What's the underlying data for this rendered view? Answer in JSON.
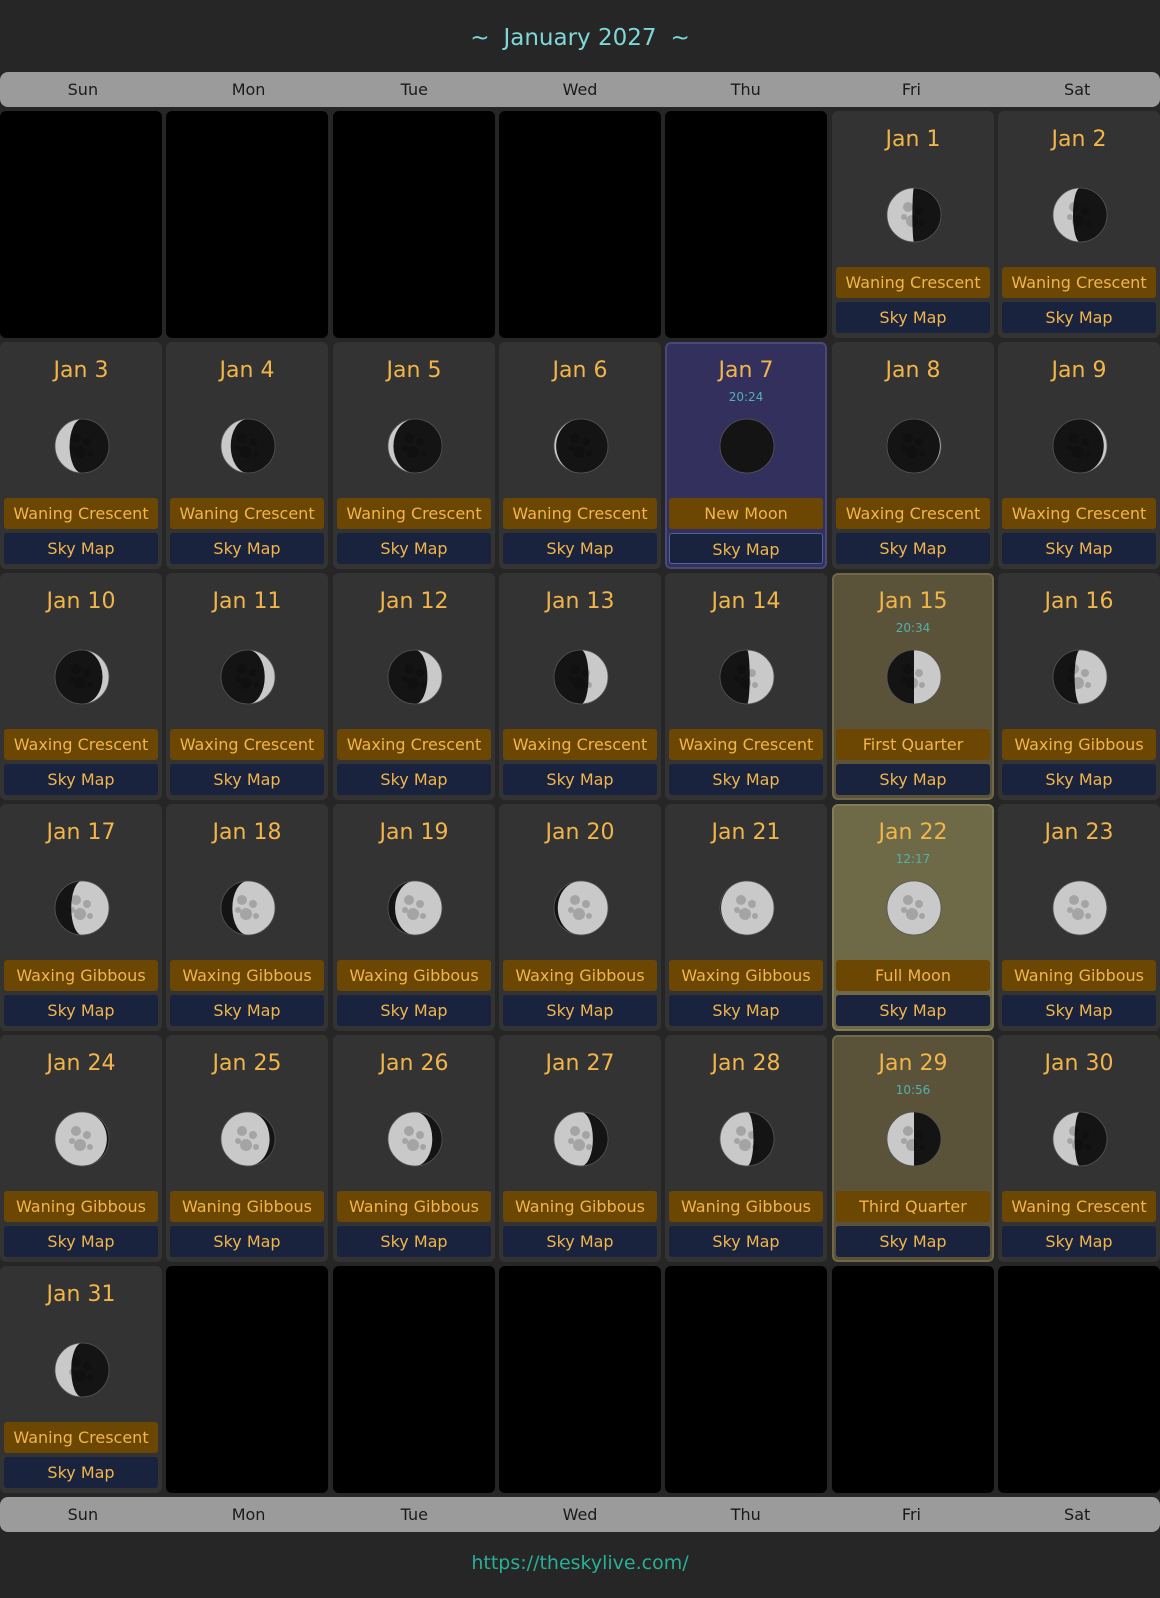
{
  "header": {
    "title": "January 2027",
    "tilde_left": "~",
    "tilde_right": "~"
  },
  "weekdays": [
    "Sun",
    "Mon",
    "Tue",
    "Wed",
    "Thu",
    "Fri",
    "Sat"
  ],
  "sky_map_label": "Sky Map",
  "leading_blanks": 5,
  "days": [
    {
      "label": "Jan 1",
      "phase": "Waning Crescent",
      "illum": 0.47,
      "waxing": false
    },
    {
      "label": "Jan 2",
      "phase": "Waning Crescent",
      "illum": 0.37,
      "waxing": false
    },
    {
      "label": "Jan 3",
      "phase": "Waning Crescent",
      "illum": 0.27,
      "waxing": false
    },
    {
      "label": "Jan 4",
      "phase": "Waning Crescent",
      "illum": 0.18,
      "waxing": false
    },
    {
      "label": "Jan 5",
      "phase": "Waning Crescent",
      "illum": 0.1,
      "waxing": false
    },
    {
      "label": "Jan 6",
      "phase": "Waning Crescent",
      "illum": 0.04,
      "waxing": false
    },
    {
      "label": "Jan 7",
      "time": "20:24",
      "phase": "New Moon",
      "illum": 0.0,
      "waxing": true,
      "highlight": "new"
    },
    {
      "label": "Jan 8",
      "phase": "Waxing Crescent",
      "illum": 0.02,
      "waxing": true
    },
    {
      "label": "Jan 9",
      "phase": "Waxing Crescent",
      "illum": 0.06,
      "waxing": true
    },
    {
      "label": "Jan 10",
      "phase": "Waxing Crescent",
      "illum": 0.12,
      "waxing": true
    },
    {
      "label": "Jan 11",
      "phase": "Waxing Crescent",
      "illum": 0.19,
      "waxing": true
    },
    {
      "label": "Jan 12",
      "phase": "Waxing Crescent",
      "illum": 0.27,
      "waxing": true
    },
    {
      "label": "Jan 13",
      "phase": "Waxing Crescent",
      "illum": 0.36,
      "waxing": true
    },
    {
      "label": "Jan 14",
      "phase": "Waxing Crescent",
      "illum": 0.45,
      "waxing": true
    },
    {
      "label": "Jan 15",
      "time": "20:34",
      "phase": "First Quarter",
      "illum": 0.5,
      "waxing": true,
      "highlight": "fq"
    },
    {
      "label": "Jan 16",
      "phase": "Waxing Gibbous",
      "illum": 0.6,
      "waxing": true
    },
    {
      "label": "Jan 17",
      "phase": "Waxing Gibbous",
      "illum": 0.7,
      "waxing": true
    },
    {
      "label": "Jan 18",
      "phase": "Waxing Gibbous",
      "illum": 0.79,
      "waxing": true
    },
    {
      "label": "Jan 19",
      "phase": "Waxing Gibbous",
      "illum": 0.87,
      "waxing": true
    },
    {
      "label": "Jan 20",
      "phase": "Waxing Gibbous",
      "illum": 0.93,
      "waxing": true
    },
    {
      "label": "Jan 21",
      "phase": "Waxing Gibbous",
      "illum": 0.98,
      "waxing": true
    },
    {
      "label": "Jan 22",
      "time": "12:17",
      "phase": "Full Moon",
      "illum": 1.0,
      "waxing": true,
      "highlight": "full"
    },
    {
      "label": "Jan 23",
      "phase": "Waning Gibbous",
      "illum": 0.99,
      "waxing": false
    },
    {
      "label": "Jan 24",
      "phase": "Waning Gibbous",
      "illum": 0.96,
      "waxing": false
    },
    {
      "label": "Jan 25",
      "phase": "Waning Gibbous",
      "illum": 0.9,
      "waxing": false
    },
    {
      "label": "Jan 26",
      "phase": "Waning Gibbous",
      "illum": 0.82,
      "waxing": false
    },
    {
      "label": "Jan 27",
      "phase": "Waning Gibbous",
      "illum": 0.72,
      "waxing": false
    },
    {
      "label": "Jan 28",
      "phase": "Waning Gibbous",
      "illum": 0.62,
      "waxing": false
    },
    {
      "label": "Jan 29",
      "time": "10:56",
      "phase": "Third Quarter",
      "illum": 0.5,
      "waxing": false,
      "highlight": "tq"
    },
    {
      "label": "Jan 30",
      "phase": "Waning Crescent",
      "illum": 0.4,
      "waxing": false
    },
    {
      "label": "Jan 31",
      "phase": "Waning Crescent",
      "illum": 0.3,
      "waxing": false
    }
  ],
  "footer": {
    "link": "https://theskylive.com/"
  },
  "colors": {
    "background": "#262626",
    "accent_date": "#f2b54a",
    "title": "#7fd8d8",
    "time": "#54b0ad",
    "link": "#27b098"
  }
}
